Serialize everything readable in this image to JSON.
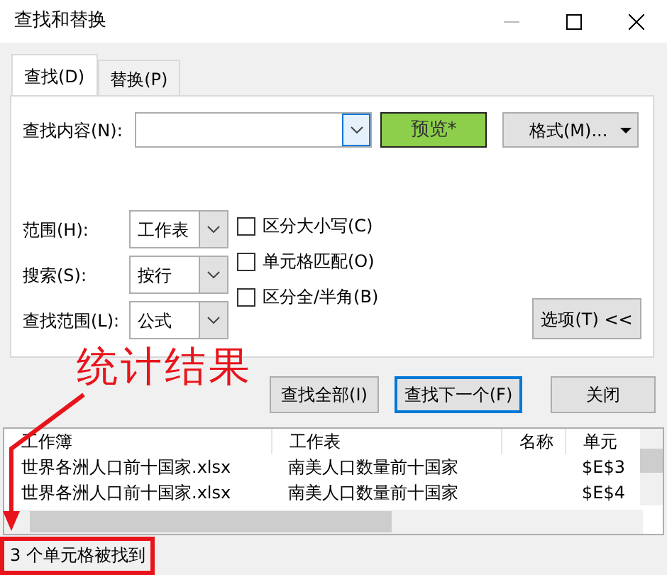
{
  "window": {
    "title": "查找和替换"
  },
  "tabs": [
    {
      "label": "查找(D)",
      "selected": true
    },
    {
      "label": "替换(P)",
      "selected": false
    }
  ],
  "find": {
    "label": "查找内容(N):"
  },
  "preview_button": "预览*",
  "format_button": "格式(M)...",
  "options": [
    {
      "label": "范围(H):",
      "value": "工作表"
    },
    {
      "label": "搜索(S):",
      "value": "按行"
    },
    {
      "label": "查找范围(L):",
      "value": "公式"
    }
  ],
  "checkboxes": [
    {
      "label": "区分大小写(C)",
      "checked": false
    },
    {
      "label": "单元格匹配(O)",
      "checked": false
    },
    {
      "label": "区分全/半角(B)",
      "checked": false
    }
  ],
  "options_button": "选项(T) <<",
  "buttons": [
    {
      "label": "查找全部(I)",
      "default": false
    },
    {
      "label": "查找下一个(F)",
      "default": true
    },
    {
      "label": "关闭",
      "default": false
    }
  ],
  "results": {
    "columns": [
      "工作簿",
      "工作表",
      "名称",
      "单元"
    ],
    "rows": [
      [
        "世界各洲人口前十国家.xlsx",
        "南美人口数量前十国家",
        "",
        "$E$3"
      ],
      [
        "世界各洲人口前十国家.xlsx",
        "南美人口数量前十国家",
        "",
        "$E$4"
      ]
    ]
  },
  "status_bar": "3 个单元格被找到",
  "annotation": "统计结果"
}
